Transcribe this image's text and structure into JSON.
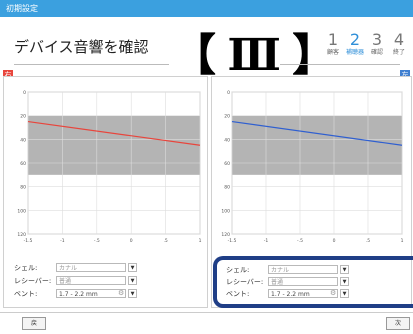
{
  "window": {
    "title": "初期設定"
  },
  "header": {
    "title": "デバイス音響を確認",
    "overlay_label": "【 Ⅲ 】",
    "steps": [
      {
        "num": "1",
        "label": "顧客",
        "active": false
      },
      {
        "num": "2",
        "label": "補聴器",
        "active": true
      },
      {
        "num": "3",
        "label": "確認",
        "active": false
      },
      {
        "num": "4",
        "label": "終了",
        "active": false
      }
    ]
  },
  "left_panel": {
    "side_label": "右",
    "side_color": "#e8453c",
    "curve_color": "#e8453c",
    "settings": {
      "shell_label": "シェル:",
      "shell_value": "カナル",
      "receiver_label": "レシーバー:",
      "receiver_value": "普通",
      "vent_label": "ベント:",
      "vent_value": "1.7 - 2.2 mm"
    }
  },
  "right_panel": {
    "side_label": "左",
    "side_color": "#3f7fd0",
    "curve_color": "#2f5fd0",
    "settings": {
      "shell_label": "シェル:",
      "shell_value": "カナル",
      "receiver_label": "レシーバー:",
      "receiver_value": "普通",
      "vent_label": "ベント:",
      "vent_value": "1.7 - 2.2 mm"
    }
  },
  "chart_data": [
    {
      "type": "line",
      "x": [
        0.125,
        8
      ],
      "series": [
        {
          "values": [
            25,
            45
          ]
        }
      ],
      "band": [
        20,
        70
      ],
      "ylim": [
        0,
        120
      ],
      "grid": true,
      "xticks": [
        "-1.5",
        "-1",
        "-.5",
        "0",
        ".5",
        "1"
      ],
      "yticks": [
        "0",
        "20",
        "40",
        "60",
        "80",
        "100",
        "120"
      ]
    },
    {
      "type": "line",
      "x": [
        0.125,
        8
      ],
      "series": [
        {
          "values": [
            25,
            45
          ]
        }
      ],
      "band": [
        20,
        70
      ],
      "ylim": [
        0,
        120
      ],
      "grid": true,
      "xticks": [
        "-1.5",
        "-1",
        "-.5",
        "0",
        ".5",
        "1"
      ],
      "yticks": [
        "0",
        "20",
        "40",
        "60",
        "80",
        "100",
        "120"
      ]
    }
  ],
  "footer": {
    "back_label": "戻",
    "next_label": "次"
  }
}
